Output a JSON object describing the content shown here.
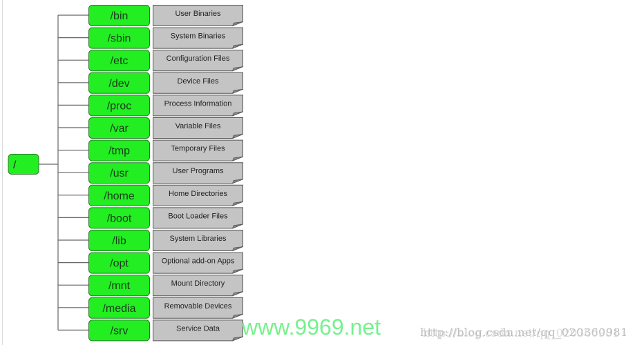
{
  "root": {
    "label": "/"
  },
  "colors": {
    "dir_fill": "#22ee22",
    "dir_stroke": "#2a7a2a",
    "desc_fill": "#c4c4c4",
    "desc_stroke": "#555555",
    "line": "#666666"
  },
  "directories": [
    {
      "name": "/bin",
      "description": "User Binaries"
    },
    {
      "name": "/sbin",
      "description": "System Binaries"
    },
    {
      "name": "/etc",
      "description": "Configuration Files"
    },
    {
      "name": "/dev",
      "description": "Device Files"
    },
    {
      "name": "/proc",
      "description": "Process Information"
    },
    {
      "name": "/var",
      "description": "Variable Files"
    },
    {
      "name": "/tmp",
      "description": "Temporary Files"
    },
    {
      "name": "/usr",
      "description": "User Programs"
    },
    {
      "name": "/home",
      "description": "Home Directories"
    },
    {
      "name": "/boot",
      "description": "Boot Loader Files"
    },
    {
      "name": "/lib",
      "description": "System Libraries"
    },
    {
      "name": "/opt",
      "description": "Optional add-on Apps"
    },
    {
      "name": "/mnt",
      "description": "Mount Directory"
    },
    {
      "name": "/media",
      "description": "Removable Devices"
    },
    {
      "name": "/srv",
      "description": "Service Data"
    }
  ],
  "watermarks": {
    "site": "www.9969.net",
    "url": "http://blog.csdn.net/qq_020360981"
  }
}
